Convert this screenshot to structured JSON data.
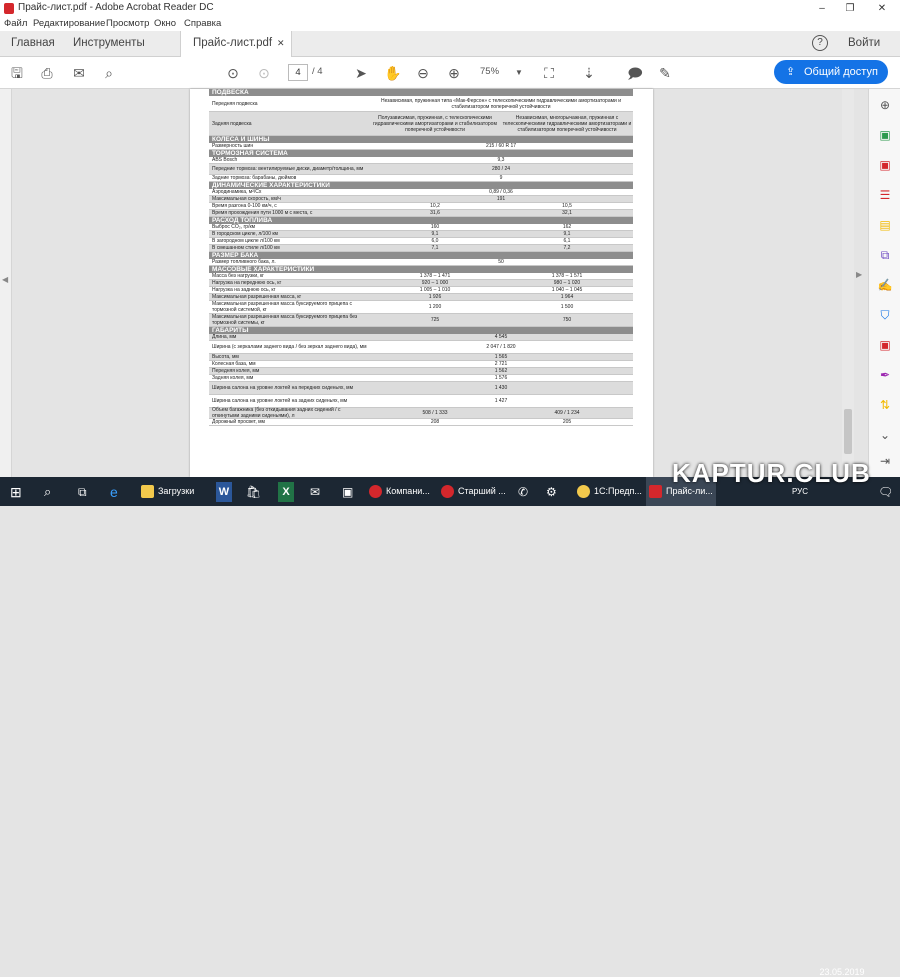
{
  "window": {
    "title": "Прайс-лист.pdf - Adobe Acrobat Reader DC",
    "min": "–",
    "max": "❐",
    "close": "✕"
  },
  "menu": [
    "Файл",
    "Редактирование",
    "Просмотр",
    "Окно",
    "Справка"
  ],
  "tabs": {
    "home": "Главная",
    "tools": "Инструменты",
    "doc": "Прайс-лист.pdf",
    "doc_close": "✕",
    "help": "?",
    "signin": "Войти"
  },
  "toolbar": {
    "page_current": "4",
    "page_total": "/  4",
    "zoom": "75%",
    "share": "Общий доступ"
  },
  "sheet": [
    {
      "t": "sec",
      "label": "ПОДВЕСКА"
    },
    {
      "t": "span",
      "label": "Передняя подвеска",
      "v": "Независимая, пружинная типа «Мак-Ферсон» с телескопическими гидравлическими амортизаторами и стабилизатором поперечной устойчивости",
      "h": 16
    },
    {
      "t": "two",
      "label": "Задняя подвеска",
      "a": "Полузависимая, пружинная, с телескопическими гидравлическими амортизаторами и стабилизатором поперечной устойчивости",
      "b": "Независимая, многорычажная, пружинная с телескопическими гидравлическими амортизаторами и стабилизатором поперечной устойчивости",
      "h": 24,
      "alt": true
    },
    {
      "t": "sec",
      "label": "КОЛЕСА И ШИНЫ"
    },
    {
      "t": "span",
      "label": "Размерность шин",
      "v": "215 / 60 R 17"
    },
    {
      "t": "sec",
      "label": "ТОРМОЗНАЯ СИСТЕМА"
    },
    {
      "t": "span",
      "label": "ABS Bosch",
      "v": "9,3"
    },
    {
      "t": "span",
      "label": "Передние тормоза: вентилируемые диски, диаметр/толщина, мм",
      "v": "280 / 24",
      "h": 11,
      "alt": true
    },
    {
      "t": "span",
      "label": "Задние тормоза: барабаны, дюймов",
      "v": "9"
    },
    {
      "t": "sec",
      "label": "ДИНАМИЧЕСКИЕ ХАРАКТЕРИСТИКИ"
    },
    {
      "t": "span",
      "label": "Аэродинамика, м²/Cx",
      "v": "0,89 / 0,36"
    },
    {
      "t": "span",
      "label": "Максимальная скорость, км/ч",
      "v": "191",
      "alt": true
    },
    {
      "t": "two",
      "label": "Время разгона 0-100 км/ч, с",
      "a": "10,2",
      "b": "10,5"
    },
    {
      "t": "two",
      "label": "Время прохождения пути 1000 м с места, с",
      "a": "31,6",
      "b": "32,1",
      "alt": true
    },
    {
      "t": "sec",
      "label": "РАСХОД ТОПЛИВА"
    },
    {
      "t": "two",
      "label": "Выброс CO₂, гр/км",
      "a": "160",
      "b": "162"
    },
    {
      "t": "two",
      "label": "В городском цикле, л/100 км",
      "a": "9,1",
      "b": "9,1",
      "alt": true
    },
    {
      "t": "two",
      "label": "В загородном цикле л/100 км",
      "a": "6,0",
      "b": "6,1"
    },
    {
      "t": "two",
      "label": "В смешанном стиле л/100 км",
      "a": "7,1",
      "b": "7,2",
      "alt": true
    },
    {
      "t": "sec",
      "label": "РАЗМЕР БАКА"
    },
    {
      "t": "span",
      "label": "Размер топливного бака, л.",
      "v": "50"
    },
    {
      "t": "sec",
      "label": "МАССОВЫЕ ХАРАКТЕРИСТИКИ"
    },
    {
      "t": "two",
      "label": "Масса без нагрузки, кг",
      "a": "1 378 – 1 471",
      "b": "1 378 – 1 571"
    },
    {
      "t": "two",
      "label": "Нагрузка на переднюю ось, кг",
      "a": "920 – 1 000",
      "b": "980 – 1 020",
      "alt": true
    },
    {
      "t": "two",
      "label": "Нагрузка на заднюю ось, кг",
      "a": "1 005 – 1 010",
      "b": "1 040 – 1 045"
    },
    {
      "t": "two",
      "label": "Максимальная разрешенная масса, кг",
      "a": "1 926",
      "b": "1 964",
      "alt": true
    },
    {
      "t": "two",
      "label": "Максимальная разрешенная масса буксируемого прицепа с тормозной системой, кг",
      "a": "1 200",
      "b": "1 500",
      "h": 13
    },
    {
      "t": "two",
      "label": "Максимальная разрешенная масса буксируемого прицепа без тормозной системы, кг",
      "a": "725",
      "b": "750",
      "h": 13,
      "alt": true
    },
    {
      "t": "sec",
      "label": "ГАБАРИТЫ"
    },
    {
      "t": "span",
      "label": "Длина, мм",
      "v": "4 545",
      "alt": true
    },
    {
      "t": "span",
      "label": "Ширина (с зеркалами заднего вида / без зеркал заднего вида), мм",
      "v": "2 047 / 1 820",
      "h": 13
    },
    {
      "t": "span",
      "label": "Высота, мм",
      "v": "1 565",
      "alt": true
    },
    {
      "t": "span",
      "label": "Колесная база, мм",
      "v": "2 721"
    },
    {
      "t": "span",
      "label": "Передняя колея, мм",
      "v": "1 562",
      "alt": true
    },
    {
      "t": "span",
      "label": "Задняя колея, мм",
      "v": "1 576"
    },
    {
      "t": "span",
      "label": "Ширина салона на уровне локтей на передних сиденьях, мм",
      "v": "1 430",
      "h": 13,
      "alt": true
    },
    {
      "t": "span",
      "label": "Ширина салона на уровне локтей на задних сиденьях, мм",
      "v": "1 427",
      "h": 13
    },
    {
      "t": "two",
      "label": "Объем багажника (без откидывания задних сидений / с откинутыми задними сиденьями), л",
      "a": "508 / 1 333",
      "b": "409 / 1 234",
      "h": 11,
      "alt": true
    },
    {
      "t": "two",
      "label": "Дорожный просвет, мм",
      "a": "208",
      "b": "205"
    }
  ],
  "taskbar": {
    "apps": [
      "Загрузки",
      "Компани...",
      "Старший ...",
      "1С:Предп...",
      "Прайс-ли..."
    ],
    "lang": "РУС",
    "date": "23.05.2019"
  },
  "watermark": "KAPTUR.CLUB"
}
